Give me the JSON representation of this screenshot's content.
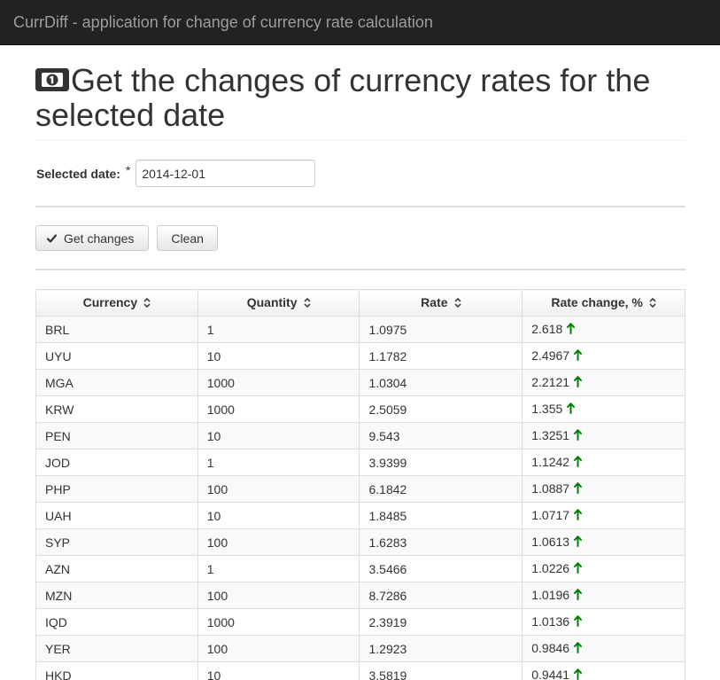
{
  "app": {
    "brand": "CurrDiff - application for change of currency rate calculation"
  },
  "header": {
    "title": "Get the changes of currency rates for the selected date",
    "icon": "money-icon"
  },
  "form": {
    "date_label": "Selected date:",
    "required_mark": "*",
    "date_value": "2014-12-01"
  },
  "actions": {
    "get_changes_label": "Get changes",
    "clean_label": "Clean"
  },
  "table": {
    "columns": [
      "Currency",
      "Quantity",
      "Rate",
      "Rate change, %"
    ],
    "rows": [
      [
        "BRL",
        "1",
        "1.0975",
        "2.618"
      ],
      [
        "UYU",
        "10",
        "1.1782",
        "2.4967"
      ],
      [
        "MGA",
        "1000",
        "1.0304",
        "2.2121"
      ],
      [
        "KRW",
        "1000",
        "2.5059",
        "1.355"
      ],
      [
        "PEN",
        "10",
        "9.543",
        "1.3251"
      ],
      [
        "JOD",
        "1",
        "3.9399",
        "1.1242"
      ],
      [
        "PHP",
        "100",
        "6.1842",
        "1.0887"
      ],
      [
        "UAH",
        "10",
        "1.8485",
        "1.0717"
      ],
      [
        "SYP",
        "100",
        "1.6283",
        "1.0613"
      ],
      [
        "AZN",
        "1",
        "3.5466",
        "1.0226"
      ],
      [
        "MZN",
        "100",
        "8.7286",
        "1.0196"
      ],
      [
        "IQD",
        "1000",
        "2.3919",
        "1.0136"
      ],
      [
        "YER",
        "100",
        "1.2923",
        "0.9846"
      ],
      [
        "HKD",
        "10",
        "3.5819",
        "0.9441"
      ]
    ],
    "trend_color": "#008000"
  }
}
